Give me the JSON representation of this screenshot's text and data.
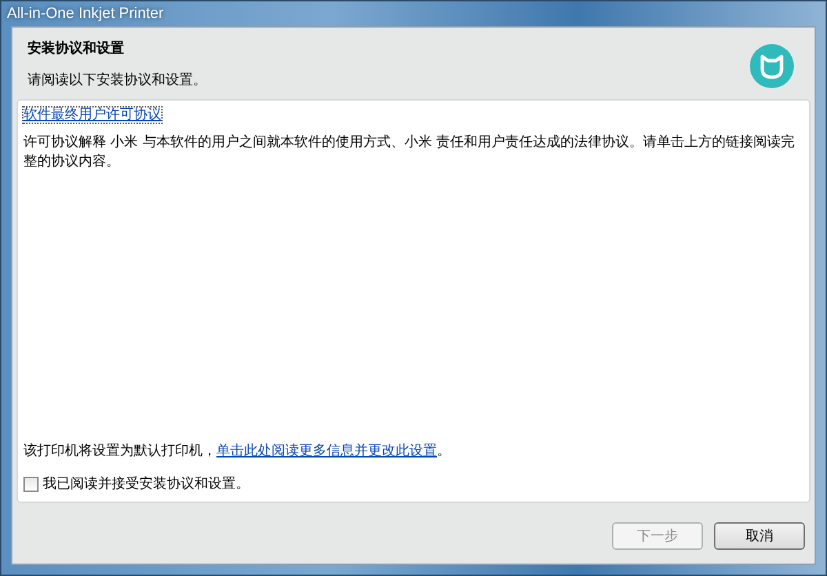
{
  "window": {
    "title": "All-in-One Inkjet Printer"
  },
  "header": {
    "title": "安装协议和设置",
    "subtitle": "请阅读以下安装协议和设置。"
  },
  "agreement": {
    "link": "软件最终用户许可协议",
    "text": "许可协议解释 小米 与本软件的用户之间就本软件的使用方式、小米 责任和用户责任达成的法律协议。请单击上方的链接阅读完整的协议内容。"
  },
  "default_printer": {
    "text": "该打印机将设置为默认打印机，",
    "link": "单击此处阅读更多信息并更改此设置",
    "suffix": "。"
  },
  "accept": {
    "label": "我已阅读并接受安装协议和设置。",
    "checked": false
  },
  "buttons": [
    {
      "label": "下一步",
      "disabled": true
    },
    {
      "label": "取消",
      "disabled": false
    }
  ]
}
